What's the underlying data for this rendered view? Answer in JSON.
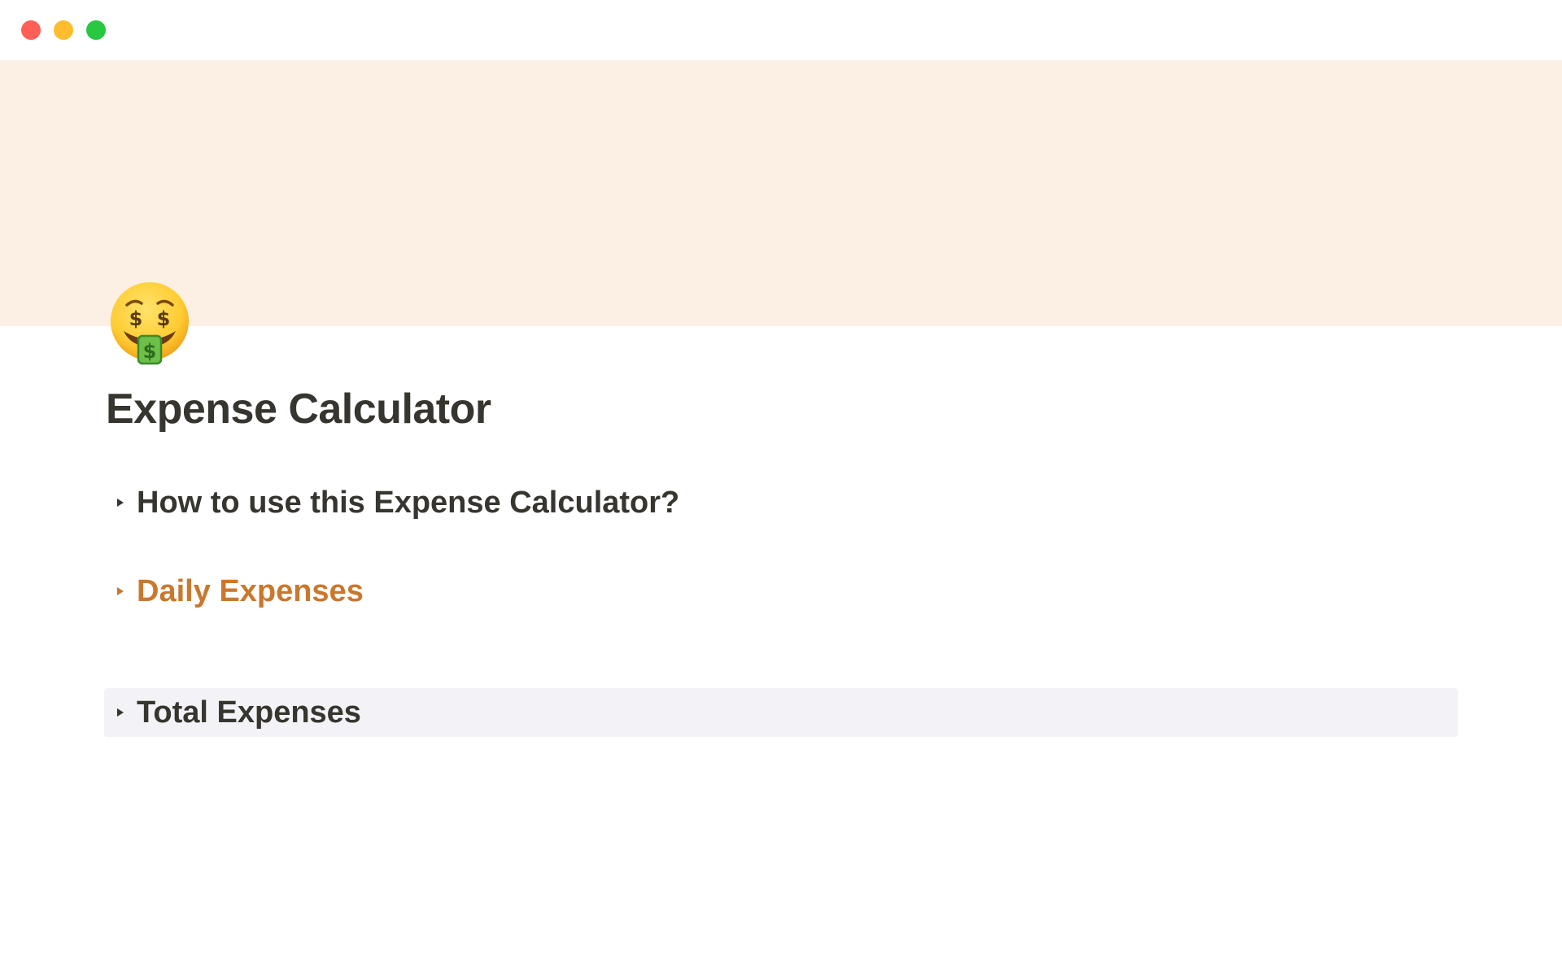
{
  "window": {
    "traffic_lights": [
      {
        "name": "close",
        "color": "#ff5f57"
      },
      {
        "name": "minimize",
        "color": "#febc2e"
      },
      {
        "name": "zoom",
        "color": "#28c840"
      }
    ]
  },
  "cover": {
    "color": "#fcf0e4"
  },
  "page": {
    "icon": "money-mouth-face-icon",
    "title": "Expense Calculator"
  },
  "toggles": [
    {
      "label": "How to use this Expense Calculator?",
      "color": "#37352f",
      "background": "",
      "expanded": false
    },
    {
      "label": "Daily Expenses",
      "color": "#c9782e",
      "background": "",
      "expanded": false
    },
    {
      "label": "Total Expenses",
      "color": "#37352f",
      "background": "#f3f2f7",
      "expanded": false
    }
  ]
}
